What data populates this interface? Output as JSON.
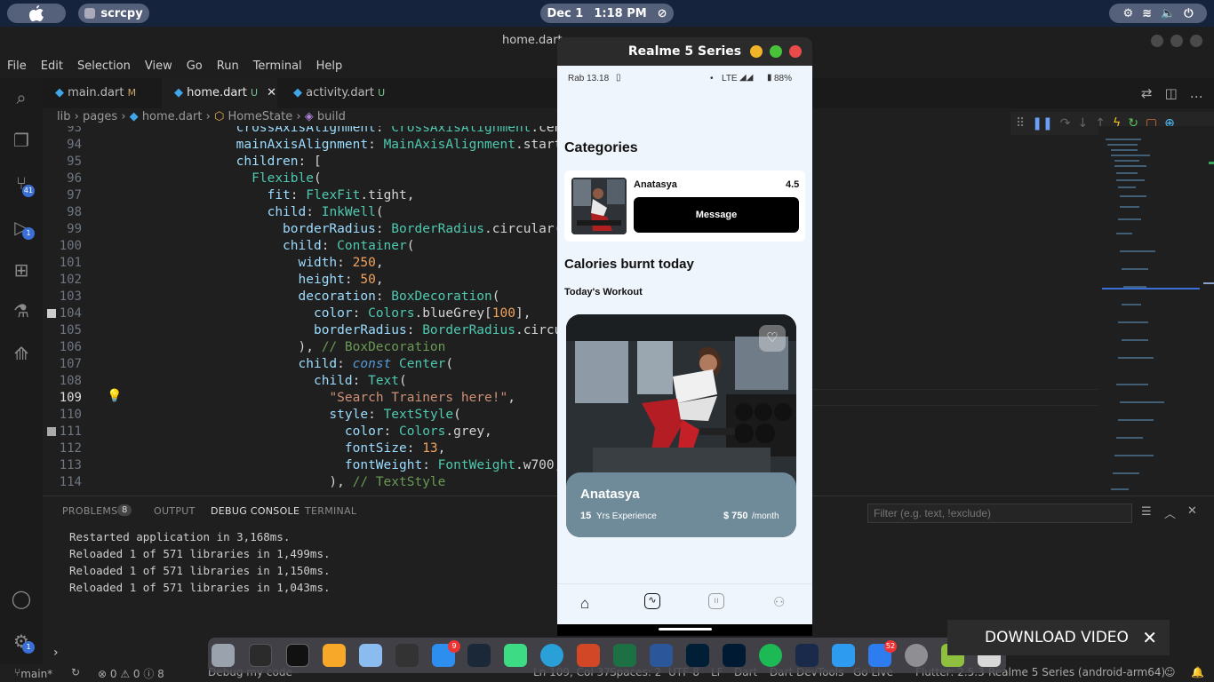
{
  "topbar": {
    "app_name": "scrcpy",
    "date": "Dec 1",
    "time": "1:18 PM"
  },
  "vscode": {
    "title": "home.dart",
    "menu": [
      "File",
      "Edit",
      "Selection",
      "View",
      "Go",
      "Run",
      "Terminal",
      "Help"
    ],
    "tabs": [
      {
        "label": "main.dart",
        "status": "M"
      },
      {
        "label": "home.dart",
        "status": "U"
      },
      {
        "label": "activity.dart",
        "status": "U"
      }
    ],
    "breadcrumb": {
      "p1": "lib",
      "p2": "pages",
      "p3": "home.dart",
      "p4": "HomeState",
      "p5": "build"
    },
    "badges": {
      "scm": "41",
      "debug": "1",
      "accounts": "1"
    },
    "line_numbers": [
      "93",
      "94",
      "95",
      "96",
      "97",
      "98",
      "99",
      "100",
      "101",
      "102",
      "103",
      "104",
      "105",
      "106",
      "107",
      "108",
      "109",
      "110",
      "111",
      "112",
      "113",
      "114"
    ],
    "panel": {
      "problems_label": "PROBLEMS",
      "problems_count": "8",
      "output_label": "OUTPUT",
      "debug_console_label": "DEBUG CONSOLE",
      "terminal_label": "TERMINAL",
      "filter_placeholder": "Filter (e.g. text, !exclude)",
      "lines": [
        "Restarted application in 3,168ms.",
        "Reloaded 1 of 571 libraries in 1,499ms.",
        "Reloaded 1 of 571 libraries in 1,150ms.",
        "Reloaded 1 of 571 libraries in 1,043ms."
      ]
    },
    "status": {
      "branch": "main*",
      "problems": "⊗ 0 ⚠ 0 ⓘ 8",
      "debug": "Debug my code",
      "position": "Ln 109, Col 37",
      "spaces": "Spaces: 2",
      "encoding": "UTF-8",
      "eol": "LF",
      "lang": "Dart",
      "devtools": "Dart DevTools",
      "golive": "Go Live",
      "flutter": "Flutter: 2.5.3",
      "device": "Realme 5 Series (android-arm64)"
    }
  },
  "dock": {
    "badge_appstore": "9",
    "badge_mail": "52"
  },
  "download_banner": "DOWNLOAD VIDEO",
  "phone": {
    "window_title": "Realme 5 Series",
    "status_left": "Rab 13.18",
    "status_right": "LTE",
    "battery": "88%",
    "categories_title": "Categories",
    "trainer_name": "Anatasya",
    "trainer_rating": "4.5",
    "message_button": "Message",
    "calories_title": "Calories burnt today",
    "workout_title": "Today's Workout",
    "card_name": "Anatasya",
    "card_years": "15",
    "card_exp": "Yrs Experience",
    "card_price": "$ 750",
    "card_per": "/month"
  },
  "colors": {
    "accent": "#3b6fd8",
    "card_overlay": "#6f8a98",
    "button": "#000000"
  }
}
